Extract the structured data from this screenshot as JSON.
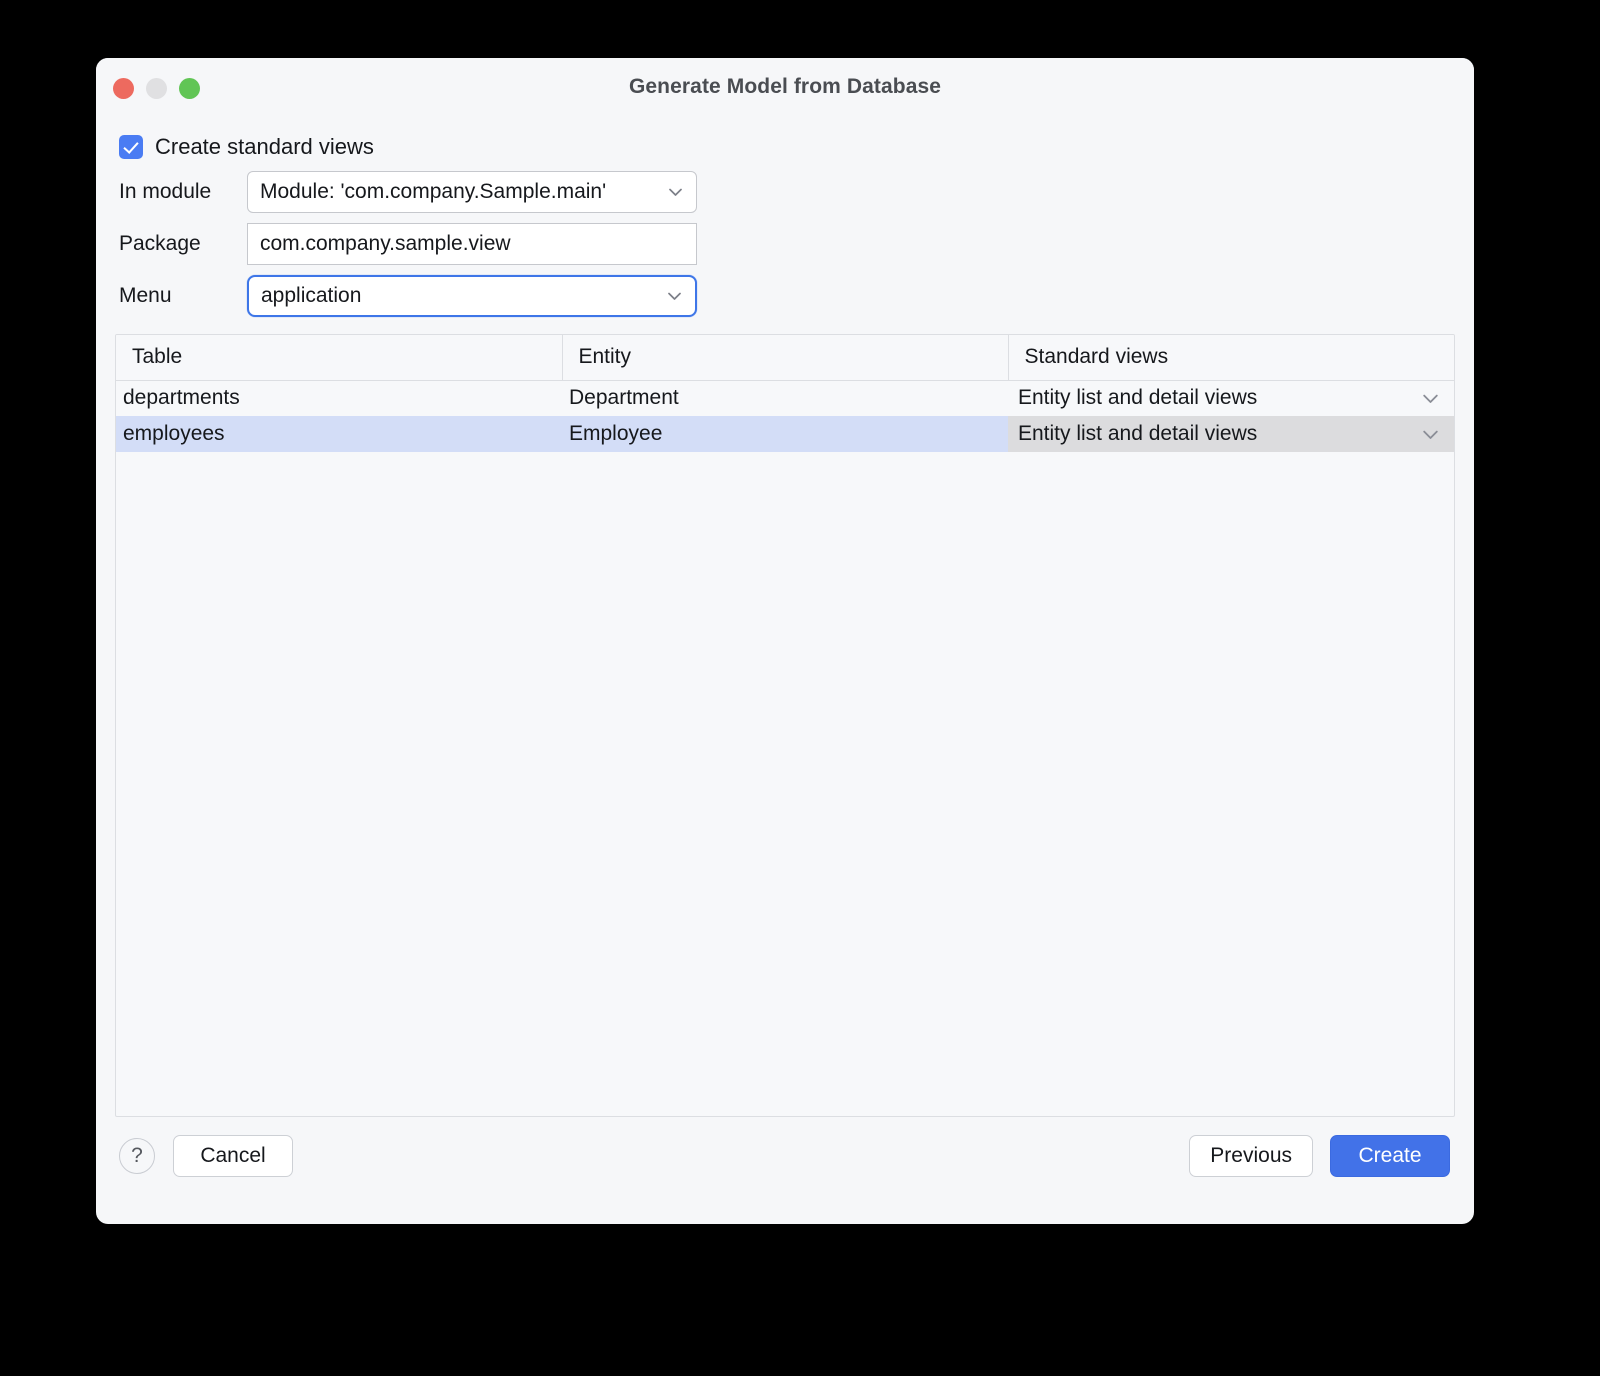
{
  "window": {
    "title": "Generate Model from Database",
    "traffic_lights": [
      "close",
      "minimize",
      "zoom"
    ]
  },
  "form": {
    "create_standard_views": {
      "label": "Create standard views",
      "checked": true
    },
    "in_module": {
      "label": "In module",
      "value": "Module: 'com.company.Sample.main'"
    },
    "package": {
      "label": "Package",
      "value": "com.company.sample.view"
    },
    "menu": {
      "label": "Menu",
      "value": "application",
      "focused": true
    }
  },
  "table": {
    "columns": [
      "Table",
      "Entity",
      "Standard views"
    ],
    "rows": [
      {
        "table": "departments",
        "entity": "Department",
        "standard_views": "Entity list and detail views",
        "selected": false
      },
      {
        "table": "employees",
        "entity": "Employee",
        "standard_views": "Entity list and detail views",
        "selected": true
      }
    ]
  },
  "footer": {
    "help": "?",
    "cancel": "Cancel",
    "previous": "Previous",
    "create": "Create"
  },
  "colors": {
    "accent": "#4272e8",
    "checkbox": "#4a7cf3",
    "selected_row": "#d3ddf7",
    "editor_cell": "#dcdcde",
    "close": "#ed6a5f",
    "minimize": "#e0e0e2",
    "zoom": "#61c555"
  }
}
